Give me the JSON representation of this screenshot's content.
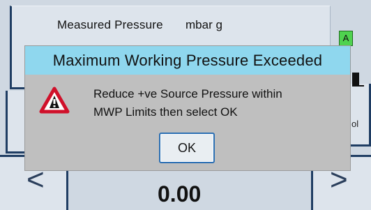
{
  "header": {
    "measured_label": "Measured Pressure",
    "unit": "mbar g",
    "status_badge": "A",
    "right_tile_text": "ol"
  },
  "navigation": {
    "left_arrow": "<",
    "right_arrow": ">"
  },
  "readings": {
    "bottom_value": "0.00"
  },
  "dialog": {
    "title": "Maximum Working Pressure Exceeded",
    "message_line1": "Reduce +ve Source Pressure within",
    "message_line2": "MWP Limits then select OK",
    "ok_label": "OK",
    "icon": "warning-triangle-icon"
  },
  "colors": {
    "dialog_title_bg": "#8fd7ee",
    "dialog_bg": "#bfbfbf",
    "warning_red": "#d0102a",
    "status_green": "#4fd24f",
    "frame_blue": "#1f3d63"
  }
}
